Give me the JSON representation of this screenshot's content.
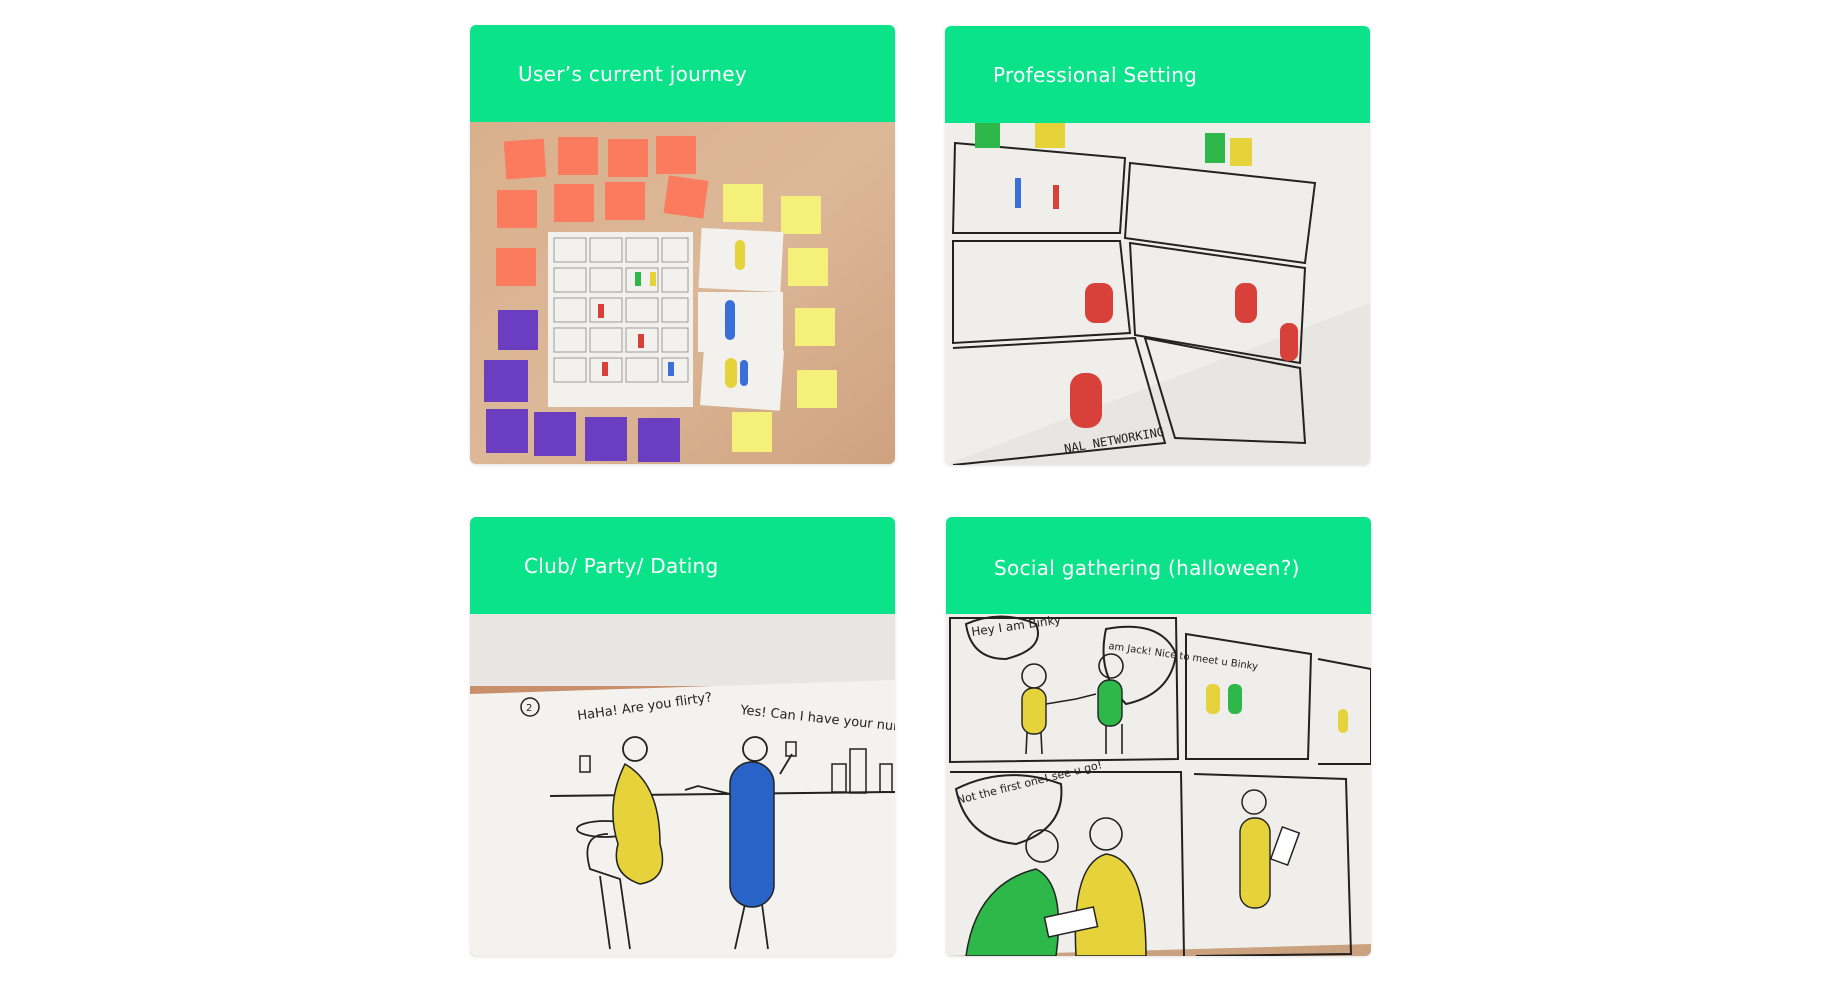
{
  "theme": {
    "accent": "#0be38a",
    "page_background": "#ffffff"
  },
  "cards": [
    {
      "title": "User’s current journey",
      "image": "photo-sticky-notes-storyboard"
    },
    {
      "title": "Professional Setting",
      "image": "photo-storyboard-professional-networking",
      "caption_text": "NAL NETWORKING"
    },
    {
      "title": "Club/ Party/ Dating",
      "image": "photo-storyboard-bar-scene",
      "speech_left": "HaHa! Are you flirty?",
      "speech_right": "Yes! Can I have your number?"
    },
    {
      "title": "Social gathering (halloween?)",
      "image": "photo-storyboard-social-gathering",
      "speech_a": "Hey I am Binky",
      "speech_b": "I am Jack! Nice to meet u Binky",
      "speech_c": "Not the first one! see u go!"
    }
  ]
}
